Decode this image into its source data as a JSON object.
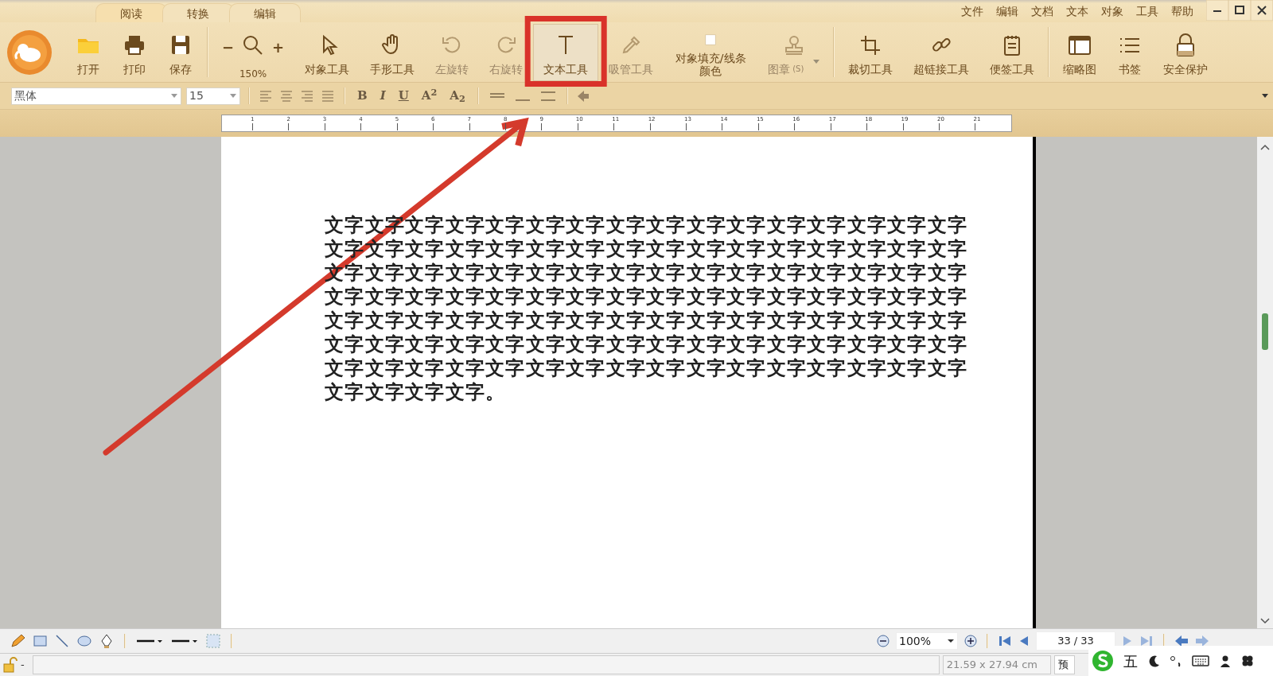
{
  "tabs": [
    {
      "label": "阅读",
      "selected": true
    },
    {
      "label": "转换",
      "selected": false
    },
    {
      "label": "编辑",
      "selected": false
    }
  ],
  "menu": [
    "文件",
    "编辑",
    "文档",
    "文本",
    "对象",
    "工具",
    "帮助"
  ],
  "toolbar_groups": [
    [
      {
        "label": "打开",
        "selected": false,
        "disabled": false
      },
      {
        "label": "打印",
        "selected": false,
        "disabled": false
      },
      {
        "label": "保存",
        "selected": false,
        "disabled": false
      }
    ],
    [
      {
        "kind": "zoom",
        "minus": "−",
        "plus": "+",
        "label": "150%",
        "selected": false,
        "disabled": false
      },
      {
        "label": "对象工具",
        "selected": false,
        "disabled": false
      },
      {
        "label": "手形工具",
        "selected": false,
        "disabled": false
      },
      {
        "label": "左旋转",
        "selected": false,
        "disabled": true
      },
      {
        "label": "右旋转",
        "selected": false,
        "disabled": true
      },
      {
        "label": "文本工具",
        "selected": true,
        "disabled": false
      },
      {
        "label": "吸管工具",
        "selected": false,
        "disabled": true
      },
      {
        "label": "对象填充/线条颜色",
        "selected": false,
        "disabled": false
      },
      {
        "kind": "dropdown",
        "label": "图章",
        "shortcut": "(S)",
        "selected": false,
        "disabled": true
      }
    ],
    [
      {
        "label": "裁切工具",
        "selected": false,
        "disabled": false
      },
      {
        "label": "超链接工具",
        "selected": false,
        "disabled": false
      },
      {
        "label": "便签工具",
        "selected": false,
        "disabled": false
      }
    ],
    [
      {
        "label": "缩略图",
        "selected": false,
        "disabled": false
      },
      {
        "label": "书签",
        "selected": false,
        "disabled": false
      },
      {
        "label": "安全保护",
        "selected": false,
        "disabled": false
      }
    ]
  ],
  "format_bar": {
    "font": "黑体",
    "size": "15",
    "styles": [
      "B",
      "I",
      "U",
      "A$^{2}$",
      "A$_{2}$"
    ]
  },
  "ruler": [
    "1",
    "2",
    "3",
    "4",
    "5",
    "6",
    "7",
    "8",
    "9",
    "10",
    "11",
    "12",
    "13",
    "14",
    "15",
    "16",
    "17",
    "18",
    "19",
    "20",
    "21"
  ],
  "document": {
    "text": "文字文字文字文字文字文字文字文字文字文字文字文字文字文字文字文字文字文字文字文字文字文字文字文字文字文字文字文字文字文字文字文字文字文字文字文字文字文字文字文字文字文字文字文字文字文字文字文字文字文字文字文字文字文字文字文字文字文字文字文字文字文字文字文字文字文字文字文字文字文字文字文字文字文字文字文字文字文字文字文字文字文字文字文字文字文字文字文字文字文字文字文字文字文字文字文字文字文字文字文字文字文字文字文字文字文字文字文字文字文字文字文字文字文字文字文字。"
  },
  "bottom_toolbar": {
    "zoom": "100%",
    "page": "33 / 33"
  },
  "status_bar": {
    "lock_state": "-",
    "page_size": "21.59 x 27.94 cm",
    "view": "预"
  },
  "ime_bar": {
    "mode": "五"
  }
}
